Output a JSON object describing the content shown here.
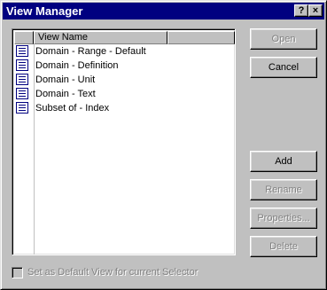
{
  "window": {
    "title": "View Manager",
    "help_button": "?",
    "close_button": "×"
  },
  "listview": {
    "column_header": "View Name",
    "items": [
      {
        "label": "Domain - Range - Default",
        "icon": "view-list-icon"
      },
      {
        "label": "Domain - Definition",
        "icon": "view-list-icon"
      },
      {
        "label": "Domain - Unit",
        "icon": "view-list-icon"
      },
      {
        "label": "Domain - Text",
        "icon": "view-list-icon"
      },
      {
        "label": "Subset of - Index",
        "icon": "view-list-icon"
      }
    ]
  },
  "buttons": {
    "open": "Open",
    "cancel": "Cancel",
    "add": "Add",
    "rename": "Rename",
    "properties": "Properties...",
    "delete": "Delete"
  },
  "default_view_checkbox": {
    "label": "Set as Default View for current Selector",
    "checked": false,
    "enabled": false
  },
  "colors": {
    "titlebar": "#000080",
    "dialog_face": "#c0c0c0",
    "disabled_text": "#808080"
  }
}
